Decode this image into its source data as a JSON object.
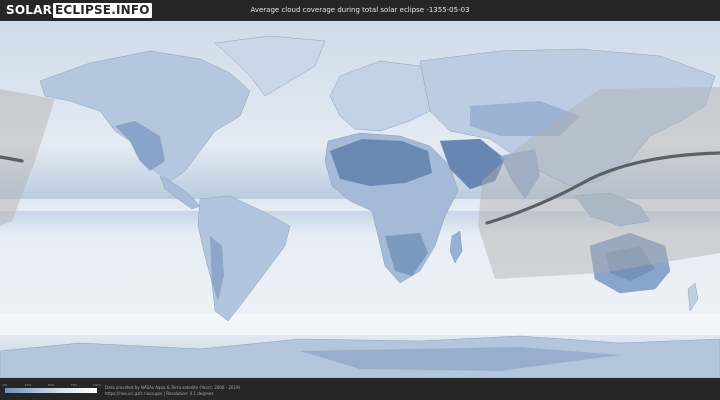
{
  "header": {
    "logo_left": "SOLAR",
    "logo_mid": "ECLIPSE",
    "logo_right": ".INFO",
    "title": "Average cloud coverage during total solar eclipse -1355-05-03"
  },
  "legend": {
    "ticks": [
      "0%",
      "25%",
      "50%",
      "75%",
      "100%"
    ],
    "colors": [
      "#6e8fb8",
      "#a9bfd9",
      "#dfe8f2",
      "#ffffff"
    ]
  },
  "credits": {
    "line1": "Data provided by NASAs Aqua & Terra satellite (Years: 2000 - 2019)",
    "line2": "https://neo.sci.gsfc.nasa.gov  |  Resolution: 0.1 degrees"
  },
  "map": {
    "ocean_color": "#dde6f0",
    "land_color": "#8aa6c8",
    "dry_land_color": "#5f7fab",
    "shadow_color": "#a8a8a8",
    "path_color": "#555b62"
  }
}
